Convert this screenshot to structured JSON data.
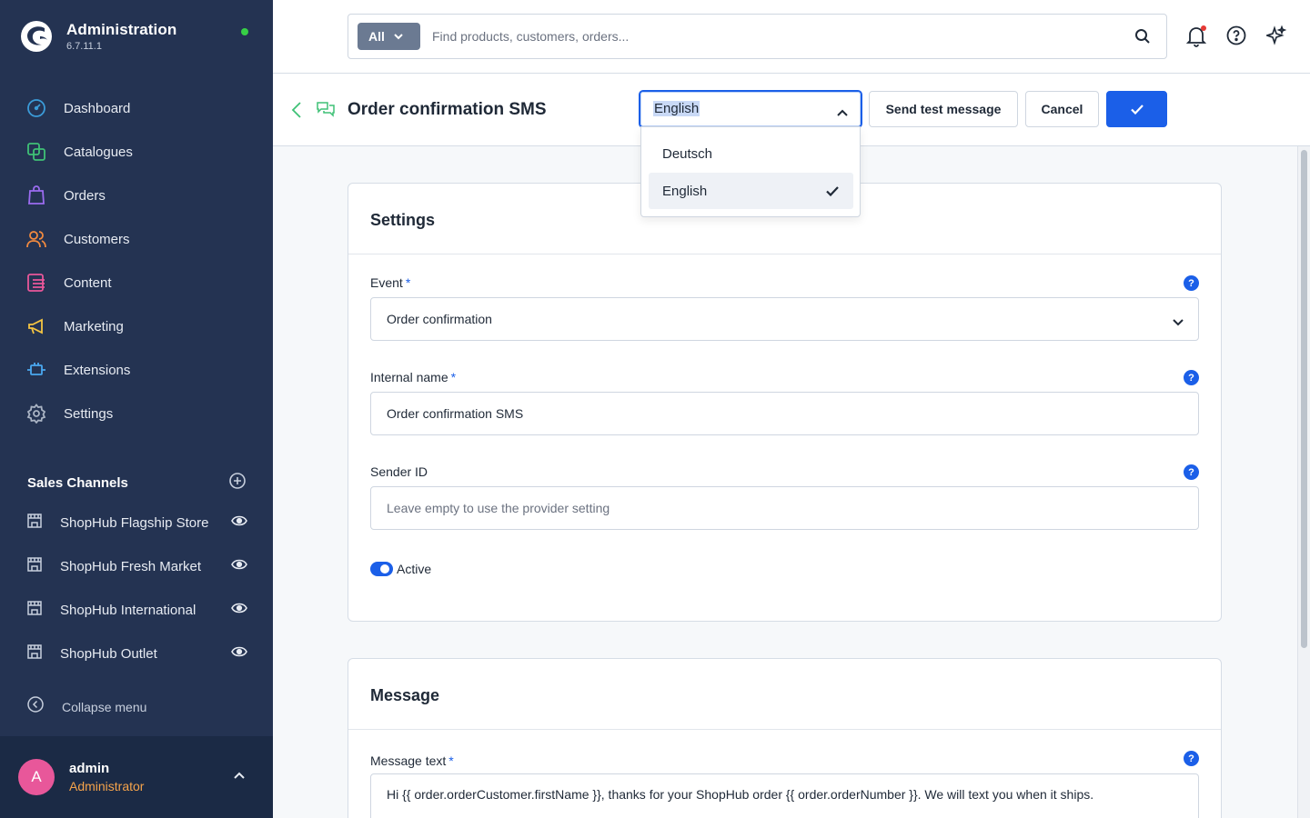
{
  "app": {
    "title": "Administration",
    "version": "6.7.11.1"
  },
  "nav": {
    "items": [
      {
        "label": "Dashboard",
        "icon": "dashboard-icon",
        "color": "#3b9bd8"
      },
      {
        "label": "Catalogues",
        "icon": "catalogues-icon",
        "color": "#3fc176"
      },
      {
        "label": "Orders",
        "icon": "orders-icon",
        "color": "#9b6cf0"
      },
      {
        "label": "Customers",
        "icon": "customers-icon",
        "color": "#f28a3f"
      },
      {
        "label": "Content",
        "icon": "content-icon",
        "color": "#e8579a"
      },
      {
        "label": "Marketing",
        "icon": "marketing-icon",
        "color": "#f5c542"
      },
      {
        "label": "Extensions",
        "icon": "extensions-icon",
        "color": "#4aa8f0"
      },
      {
        "label": "Settings",
        "icon": "settings-icon",
        "color": "#aab4c4"
      }
    ]
  },
  "sales_channels": {
    "title": "Sales Channels",
    "items": [
      {
        "label": "ShopHub Flagship Store"
      },
      {
        "label": "ShopHub Fresh Market"
      },
      {
        "label": "ShopHub International"
      },
      {
        "label": "ShopHub Outlet"
      }
    ]
  },
  "collapse_label": "Collapse menu",
  "user": {
    "initial": "A",
    "name": "admin",
    "role": "Administrator"
  },
  "search": {
    "scope": "All",
    "placeholder": "Find products, customers, orders..."
  },
  "header": {
    "title": "Order confirmation SMS",
    "language": "English",
    "send_test_label": "Send test message",
    "cancel_label": "Cancel"
  },
  "language_dropdown": {
    "options": [
      "Deutsch",
      "English"
    ],
    "selected": "English"
  },
  "settings_card": {
    "title": "Settings",
    "event_label": "Event",
    "event_value": "Order confirmation",
    "internal_name_label": "Internal name",
    "internal_name_value": "Order confirmation SMS",
    "sender_id_label": "Sender ID",
    "sender_id_placeholder": "Leave empty to use the provider setting",
    "active_label": "Active",
    "active": true
  },
  "message_card": {
    "title": "Message",
    "text_label": "Message text",
    "text_value": "Hi {{ order.orderCustomer.firstName }}, thanks for your ShopHub order {{ order.orderNumber }}. We will text you when it ships."
  },
  "colors": {
    "sidebar": "#243352",
    "accent": "#1b5fe8",
    "status_online": "#37d046",
    "role": "#f5a34b"
  }
}
